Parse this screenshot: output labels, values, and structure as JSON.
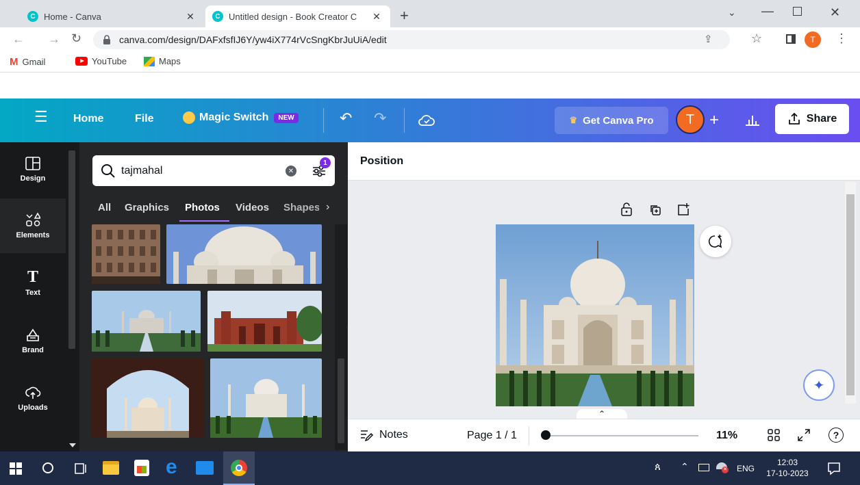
{
  "browser": {
    "tabs": [
      {
        "title": "Home - Canva",
        "active": false
      },
      {
        "title": "Untitled design - Book Creator C",
        "active": true
      }
    ],
    "url": "canva.com/design/DAFxfsfIJ6Y/yw4iX774rVcSngKbrJuUiA/edit",
    "profile_initial": "T",
    "bookmarks": [
      "Gmail",
      "YouTube",
      "Maps"
    ]
  },
  "header": {
    "home": "Home",
    "file": "File",
    "magic_switch": "Magic Switch",
    "new_badge": "NEW",
    "get_pro": "Get Canva Pro",
    "avatar_initial": "T",
    "share": "Share",
    "gradient_colors": [
      "#03a8c4",
      "#6a4ef0"
    ]
  },
  "rail": {
    "items": [
      {
        "label": "Design",
        "icon": "layout-icon"
      },
      {
        "label": "Elements",
        "icon": "shapes-icon",
        "active": true
      },
      {
        "label": "Text",
        "icon": "text-icon"
      },
      {
        "label": "Brand",
        "icon": "brand-icon"
      },
      {
        "label": "Uploads",
        "icon": "cloud-upload-icon"
      }
    ]
  },
  "panel": {
    "search_value": "tajmahal",
    "filter_count": "1",
    "categories": [
      "All",
      "Graphics",
      "Photos",
      "Videos",
      "Shapes"
    ],
    "active_category": "Photos"
  },
  "editor": {
    "context_title": "Position"
  },
  "footer": {
    "notes": "Notes",
    "page_label": "Page 1 / 1",
    "zoom": "11%"
  },
  "taskbar": {
    "language": "ENG",
    "time": "12:03",
    "date": "17-10-2023"
  }
}
